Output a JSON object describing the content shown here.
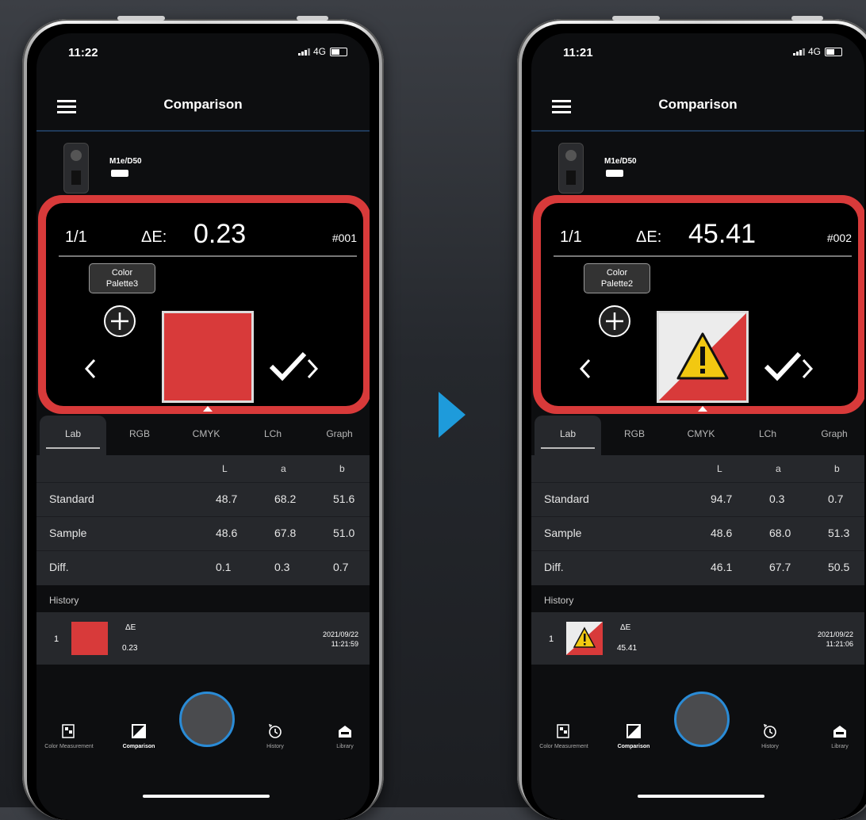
{
  "phones": [
    {
      "status": {
        "time": "11:22",
        "network": "4G"
      },
      "app_title": "Comparison",
      "device": {
        "name": "M1e/D50"
      },
      "comparison": {
        "index": "1/1",
        "delta_e_label": "ΔE:",
        "delta_e_value": "0.23",
        "sample_code": "#001",
        "palette_tag": "Color Palette3",
        "result": "pass",
        "swatch_color": "#d83a3a"
      },
      "tabs": [
        "Lab",
        "RGB",
        "CMYK",
        "LCh",
        "Graph"
      ],
      "active_tab": "Lab",
      "table": {
        "columns": [
          "L",
          "a",
          "b"
        ],
        "rows": [
          {
            "label": "Standard",
            "values": [
              "48.7",
              "68.2",
              "51.6"
            ]
          },
          {
            "label": "Sample",
            "values": [
              "48.6",
              "67.8",
              "51.0"
            ]
          },
          {
            "label": "Diff.",
            "values": [
              "0.1",
              "0.3",
              "0.7"
            ]
          }
        ]
      },
      "history": {
        "header": "History",
        "items": [
          {
            "num": "1",
            "de_label": "ΔE",
            "de_value": "0.23",
            "date": "2021/09/22",
            "time": "11:21:59"
          }
        ]
      },
      "bottom_nav": [
        "Color Measurement",
        "Comparison",
        "History",
        "Library"
      ],
      "active_nav": "Comparison"
    },
    {
      "status": {
        "time": "11:21",
        "network": "4G"
      },
      "app_title": "Comparison",
      "device": {
        "name": "M1e/D50"
      },
      "comparison": {
        "index": "1/1",
        "delta_e_label": "ΔE:",
        "delta_e_value": "45.41",
        "sample_code": "#002",
        "palette_tag": "Color Palette2",
        "result": "warning",
        "swatch_color": "#d83a3a"
      },
      "tabs": [
        "Lab",
        "RGB",
        "CMYK",
        "LCh",
        "Graph"
      ],
      "active_tab": "Lab",
      "table": {
        "columns": [
          "L",
          "a",
          "b"
        ],
        "rows": [
          {
            "label": "Standard",
            "values": [
              "94.7",
              "0.3",
              "0.7"
            ]
          },
          {
            "label": "Sample",
            "values": [
              "48.6",
              "68.0",
              "51.3"
            ]
          },
          {
            "label": "Diff.",
            "values": [
              "46.1",
              "67.7",
              "50.5"
            ]
          }
        ]
      },
      "history": {
        "header": "History",
        "items": [
          {
            "num": "1",
            "de_label": "ΔE",
            "de_value": "45.41",
            "date": "2021/09/22",
            "time": "11:21:06"
          }
        ]
      },
      "bottom_nav": [
        "Color Measurement",
        "Comparison",
        "History",
        "Library"
      ],
      "active_nav": "Comparison"
    }
  ],
  "colors": {
    "accent_red": "#d83a3a",
    "arrow_blue": "#1e9bdb",
    "shutter_ring": "#2a8bd6"
  }
}
